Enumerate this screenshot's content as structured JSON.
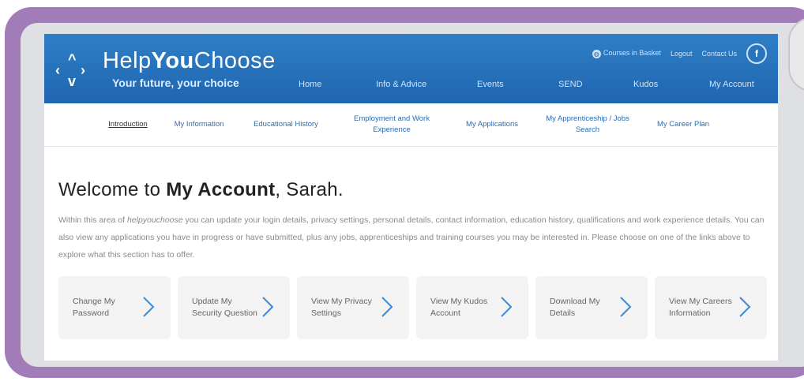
{
  "header": {
    "brand_light": "Help",
    "brand_bold": "You",
    "brand_rest": "Choose",
    "tagline": "Your future, your choice",
    "toplinks": [
      {
        "label": "Courses in Basket",
        "icon": "globe-icon"
      },
      {
        "label": "Logout"
      },
      {
        "label": "Contact Us"
      }
    ],
    "facebook": "f",
    "nav": [
      "Home",
      "Info & Advice",
      "Events",
      "SEND",
      "Kudos",
      "My Account"
    ]
  },
  "subnav": [
    {
      "label": "Introduction",
      "active": true
    },
    {
      "label": "My Information"
    },
    {
      "label": "Educational History"
    },
    {
      "label": "Employment and Work Experience"
    },
    {
      "label": "My Applications"
    },
    {
      "label": "My Apprenticeship / Jobs Search"
    },
    {
      "label": "My Career Plan"
    }
  ],
  "main": {
    "title_prefix": "Welcome to ",
    "title_bold": "My Account",
    "title_suffix": ", Sarah.",
    "intro_part1": "Within this area of ",
    "intro_em": "helpyouchoose",
    "intro_part2": " you can update your login details, privacy settings, personal details, contact information, education history, qualifications and work experience details. You can also view any applications you have in progress or have submitted, plus any jobs, apprenticeships and training courses you may be interested in. Please choose on one of the links above to explore what this section has to offer."
  },
  "cards": [
    {
      "label": "Change My Password"
    },
    {
      "label": "Update My Security Question"
    },
    {
      "label": "View My Privacy Settings"
    },
    {
      "label": "View My Kudos Account"
    },
    {
      "label": "Download My Details"
    },
    {
      "label": "View My Careers Information"
    }
  ],
  "colors": {
    "frame": "#a27cb8",
    "header": "#1f66b0",
    "link": "#2a6cb4",
    "chevron": "#3a8ad6"
  }
}
